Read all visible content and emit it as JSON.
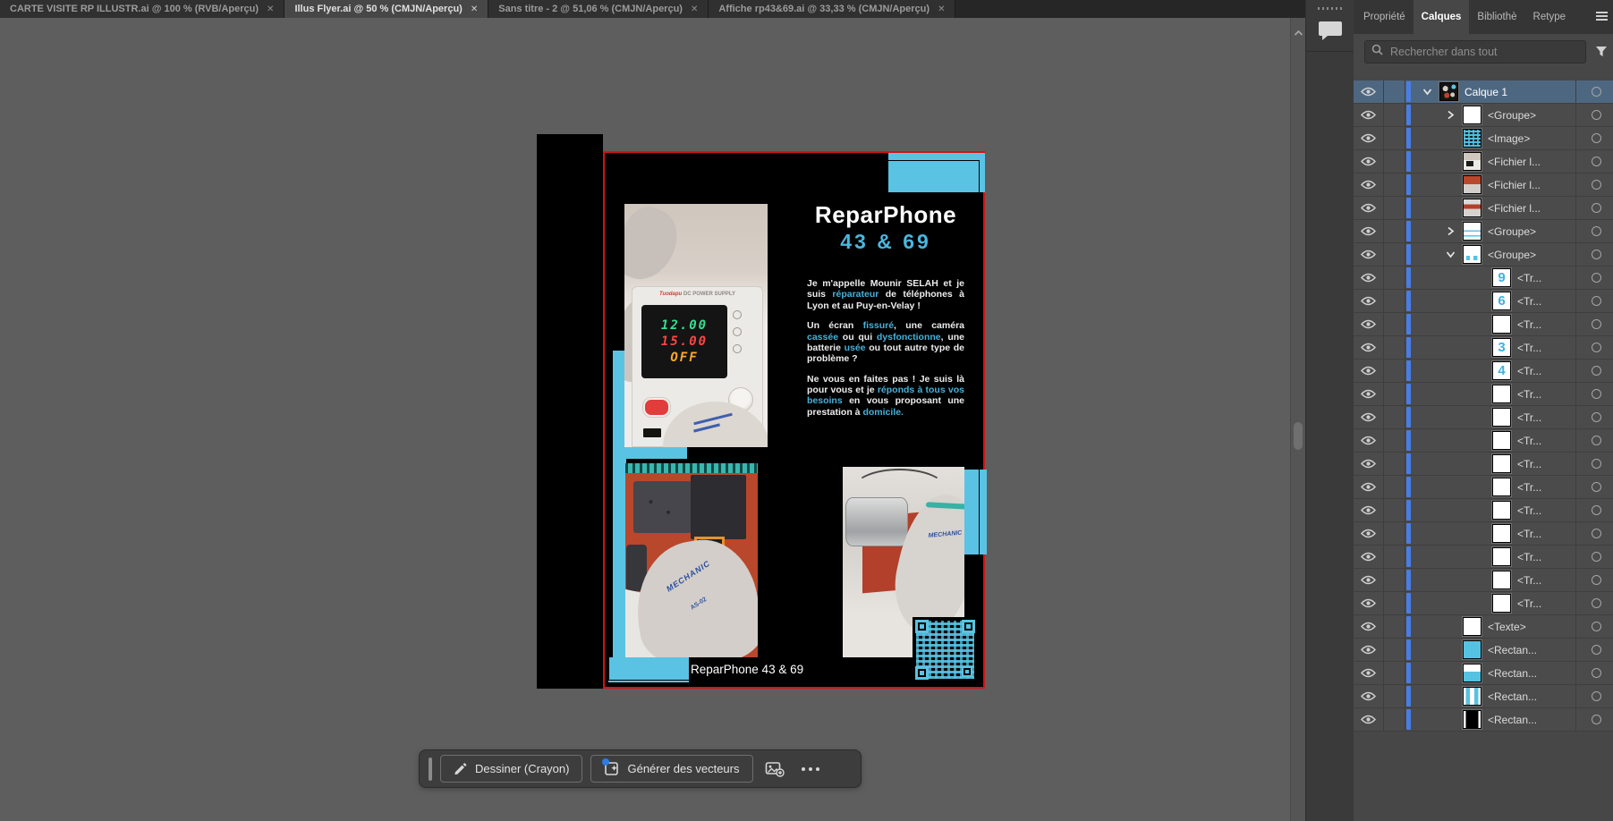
{
  "doc_tabs": [
    {
      "label": "CARTE VISITE RP ILLUSTR.ai @ 100 % (RVB/Aperçu)",
      "active": false
    },
    {
      "label": "Illus Flyer.ai @ 50 % (CMJN/Aperçu)",
      "active": true
    },
    {
      "label": "Sans titre - 2 @ 51,06 % (CMJN/Aperçu)",
      "active": false
    },
    {
      "label": "Affiche rp43&69.ai @ 33,33 % (CMJN/Aperçu)",
      "active": false
    }
  ],
  "panel": {
    "tabs": [
      {
        "label": "Propriété",
        "active": false
      },
      {
        "label": "Calques",
        "active": true
      },
      {
        "label": "Bibliothè",
        "active": false
      },
      {
        "label": "Retype",
        "active": false
      }
    ],
    "search_placeholder": "Rechercher dans tout"
  },
  "layers": [
    {
      "label": "Calque 1",
      "indent": 0,
      "chevron": "down",
      "thumb": "flyer",
      "selected": true
    },
    {
      "label": "<Groupe>",
      "indent": 1,
      "chevron": "right",
      "thumb": "white",
      "selected": false
    },
    {
      "label": "<Image>",
      "indent": 1,
      "chevron": null,
      "thumb": "qr",
      "selected": false
    },
    {
      "label": "<Fichier l...",
      "indent": 1,
      "chevron": null,
      "thumb": "photo1",
      "selected": false
    },
    {
      "label": "<Fichier l...",
      "indent": 1,
      "chevron": null,
      "thumb": "photo2",
      "selected": false
    },
    {
      "label": "<Fichier l...",
      "indent": 1,
      "chevron": null,
      "thumb": "photo3",
      "selected": false
    },
    {
      "label": "<Groupe>",
      "indent": 1,
      "chevron": "right",
      "thumb": "draw",
      "selected": false
    },
    {
      "label": "<Groupe>",
      "indent": 1,
      "chevron": "down",
      "thumb": "dashes",
      "selected": false
    },
    {
      "label": "<Tr...",
      "indent": 2,
      "chevron": null,
      "thumb": "num9",
      "selected": false
    },
    {
      "label": "<Tr...",
      "indent": 2,
      "chevron": null,
      "thumb": "num6",
      "selected": false
    },
    {
      "label": "<Tr...",
      "indent": 2,
      "chevron": null,
      "thumb": "white",
      "selected": false
    },
    {
      "label": "<Tr...",
      "indent": 2,
      "chevron": null,
      "thumb": "num3",
      "selected": false
    },
    {
      "label": "<Tr...",
      "indent": 2,
      "chevron": null,
      "thumb": "num4",
      "selected": false
    },
    {
      "label": "<Tr...",
      "indent": 2,
      "chevron": null,
      "thumb": "white",
      "selected": false
    },
    {
      "label": "<Tr...",
      "indent": 2,
      "chevron": null,
      "thumb": "white",
      "selected": false
    },
    {
      "label": "<Tr...",
      "indent": 2,
      "chevron": null,
      "thumb": "white",
      "selected": false
    },
    {
      "label": "<Tr...",
      "indent": 2,
      "chevron": null,
      "thumb": "white",
      "selected": false
    },
    {
      "label": "<Tr...",
      "indent": 2,
      "chevron": null,
      "thumb": "white",
      "selected": false
    },
    {
      "label": "<Tr...",
      "indent": 2,
      "chevron": null,
      "thumb": "white",
      "selected": false
    },
    {
      "label": "<Tr...",
      "indent": 2,
      "chevron": null,
      "thumb": "white",
      "selected": false
    },
    {
      "label": "<Tr...",
      "indent": 2,
      "chevron": null,
      "thumb": "white",
      "selected": false
    },
    {
      "label": "<Tr...",
      "indent": 2,
      "chevron": null,
      "thumb": "white",
      "selected": false
    },
    {
      "label": "<Tr...",
      "indent": 2,
      "chevron": null,
      "thumb": "white",
      "selected": false
    },
    {
      "label": "<Texte>",
      "indent": 1,
      "chevron": null,
      "thumb": "white",
      "selected": false
    },
    {
      "label": "<Rectan...",
      "indent": 1,
      "chevron": null,
      "thumb": "cyan",
      "selected": false
    },
    {
      "label": "<Rectan...",
      "indent": 1,
      "chevron": null,
      "thumb": "cyan-split",
      "selected": false
    },
    {
      "label": "<Rectan...",
      "indent": 1,
      "chevron": null,
      "thumb": "stripes",
      "selected": false
    },
    {
      "label": "<Rectan...",
      "indent": 1,
      "chevron": null,
      "thumb": "black",
      "selected": false
    }
  ],
  "flyer": {
    "title": "ReparPhone",
    "subtitle": "43 & 69",
    "caption": "ReparPhone 43 & 69",
    "paragraphs": [
      [
        {
          "t": "Je m'appelle Mounir SELAH et je suis "
        },
        {
          "t": "réparateur",
          "c": true
        },
        {
          "t": " de téléphones à Lyon et au Puy-en-Velay !"
        }
      ],
      [
        {
          "t": "Un écran "
        },
        {
          "t": "fissuré",
          "c": true
        },
        {
          "t": ", une caméra "
        },
        {
          "t": "cassée",
          "c": true
        },
        {
          "t": " ou qui "
        },
        {
          "t": "dysfonctionne",
          "c": true
        },
        {
          "t": ", une batterie "
        },
        {
          "t": "usée",
          "c": true
        },
        {
          "t": " ou tout autre type de problème ?"
        }
      ],
      [
        {
          "t": "Ne vous en faites pas ! Je suis là pour vous et je "
        },
        {
          "t": "réponds à tous vos besoins",
          "c": true
        },
        {
          "t": " en vous proposant une prestation à "
        },
        {
          "t": "domicile.",
          "c": true
        }
      ]
    ],
    "display": {
      "line1": "12.00",
      "line2": "15.00",
      "line3": "OFF"
    },
    "psu_brand": "Tuodapu",
    "psu_label": "DC POWER SUPPLY",
    "glove_brand": "MECHANIC",
    "glove_model": "AS-02"
  },
  "toolbar": {
    "draw_label": "Dessiner (Crayon)",
    "generate_label": "Générer des vecteurs"
  },
  "icons": {
    "close_glyph": "✕"
  },
  "colors": {
    "accent_cyan": "#5ac3e3",
    "accent_red": "#d51315",
    "layer_color_blue": "#4a7de4",
    "selected_row": "#4e6781"
  }
}
